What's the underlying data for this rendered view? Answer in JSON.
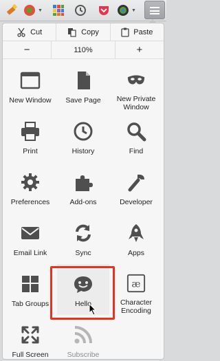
{
  "toolbar": {
    "icons": [
      "pencil-icon",
      "color-picker-icon",
      "dropdown",
      "grid-icon",
      "history-icon",
      "pocket-icon",
      "globe-icon",
      "dropdown",
      "menu-icon"
    ]
  },
  "edit": {
    "cut_label": "Cut",
    "copy_label": "Copy",
    "paste_label": "Paste"
  },
  "zoom": {
    "minus": "−",
    "level": "110%",
    "plus": "+"
  },
  "items": [
    {
      "label": "New Window",
      "icon": "new-window-icon"
    },
    {
      "label": "Save Page",
      "icon": "save-page-icon"
    },
    {
      "label": "New Private\nWindow",
      "icon": "private-window-icon"
    },
    {
      "label": "Print",
      "icon": "print-icon"
    },
    {
      "label": "History",
      "icon": "history-icon"
    },
    {
      "label": "Find",
      "icon": "find-icon"
    },
    {
      "label": "Preferences",
      "icon": "preferences-icon"
    },
    {
      "label": "Add-ons",
      "icon": "addons-icon"
    },
    {
      "label": "Developer",
      "icon": "developer-icon"
    },
    {
      "label": "Email Link",
      "icon": "email-icon"
    },
    {
      "label": "Sync",
      "icon": "sync-icon"
    },
    {
      "label": "Apps",
      "icon": "apps-icon"
    },
    {
      "label": "Tab Groups",
      "icon": "tab-groups-icon"
    },
    {
      "label": "Hello",
      "icon": "hello-icon"
    },
    {
      "label": "Character\nEncoding",
      "icon": "character-encoding-icon"
    },
    {
      "label": "Full Screen",
      "icon": "full-screen-icon"
    },
    {
      "label": "Subscribe",
      "icon": "subscribe-icon"
    }
  ],
  "colors": {
    "highlight": "#e8321e",
    "icon": "#4f4f4f",
    "dim_icon": "#b5b5b5"
  }
}
